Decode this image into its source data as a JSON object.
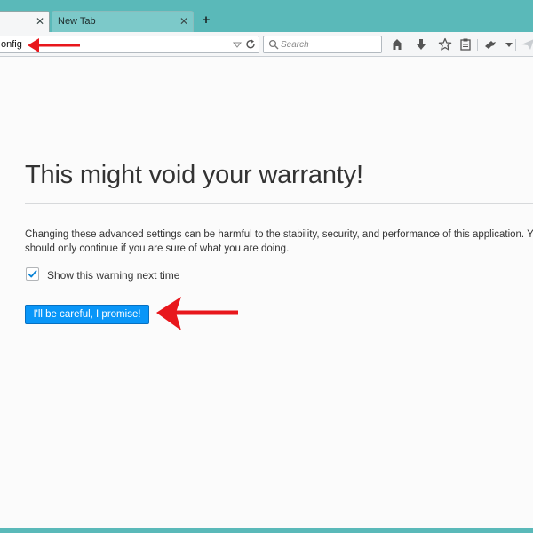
{
  "tabs": [
    {
      "label": "",
      "active": true
    },
    {
      "label": "New Tab",
      "active": false
    }
  ],
  "urlbar": {
    "value": "onfig"
  },
  "search": {
    "placeholder": "Search"
  },
  "toolbar_icons": [
    "home-icon",
    "download-icon",
    "bookmark-star-icon",
    "reading-list-icon",
    "extension-icon",
    "overflow-menu-icon",
    "send-icon"
  ],
  "page": {
    "title": "This might void your warranty!",
    "warning_line1": "Changing these advanced settings can be harmful to the stability, security, and performance of this application. You",
    "warning_line2": "should only continue if you are sure of what you are doing.",
    "checkbox_label": "Show this warning next time",
    "checkbox_checked": true,
    "accept_button": "I'll be careful, I promise!"
  },
  "colors": {
    "window_frame": "#5ab9b9",
    "accept_button": "#0996f8",
    "annotation_arrow": "#e8171c",
    "checkmark": "#0a84d6"
  }
}
